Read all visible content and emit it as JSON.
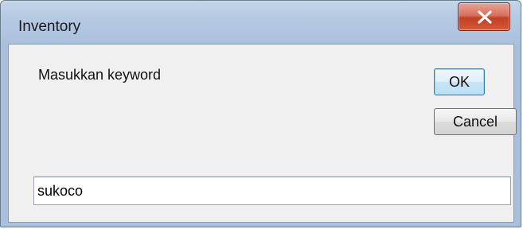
{
  "window": {
    "title": "Inventory",
    "close_icon": "close-icon"
  },
  "dialog": {
    "prompt": "Masukkan keyword",
    "ok_label": "OK",
    "cancel_label": "Cancel",
    "input_value": "sukoco"
  },
  "colors": {
    "titlebar": "#b6cae3",
    "client_bg": "#f0f0f0",
    "close_button": "#c33f22",
    "default_button_border": "#3c7fb1"
  }
}
